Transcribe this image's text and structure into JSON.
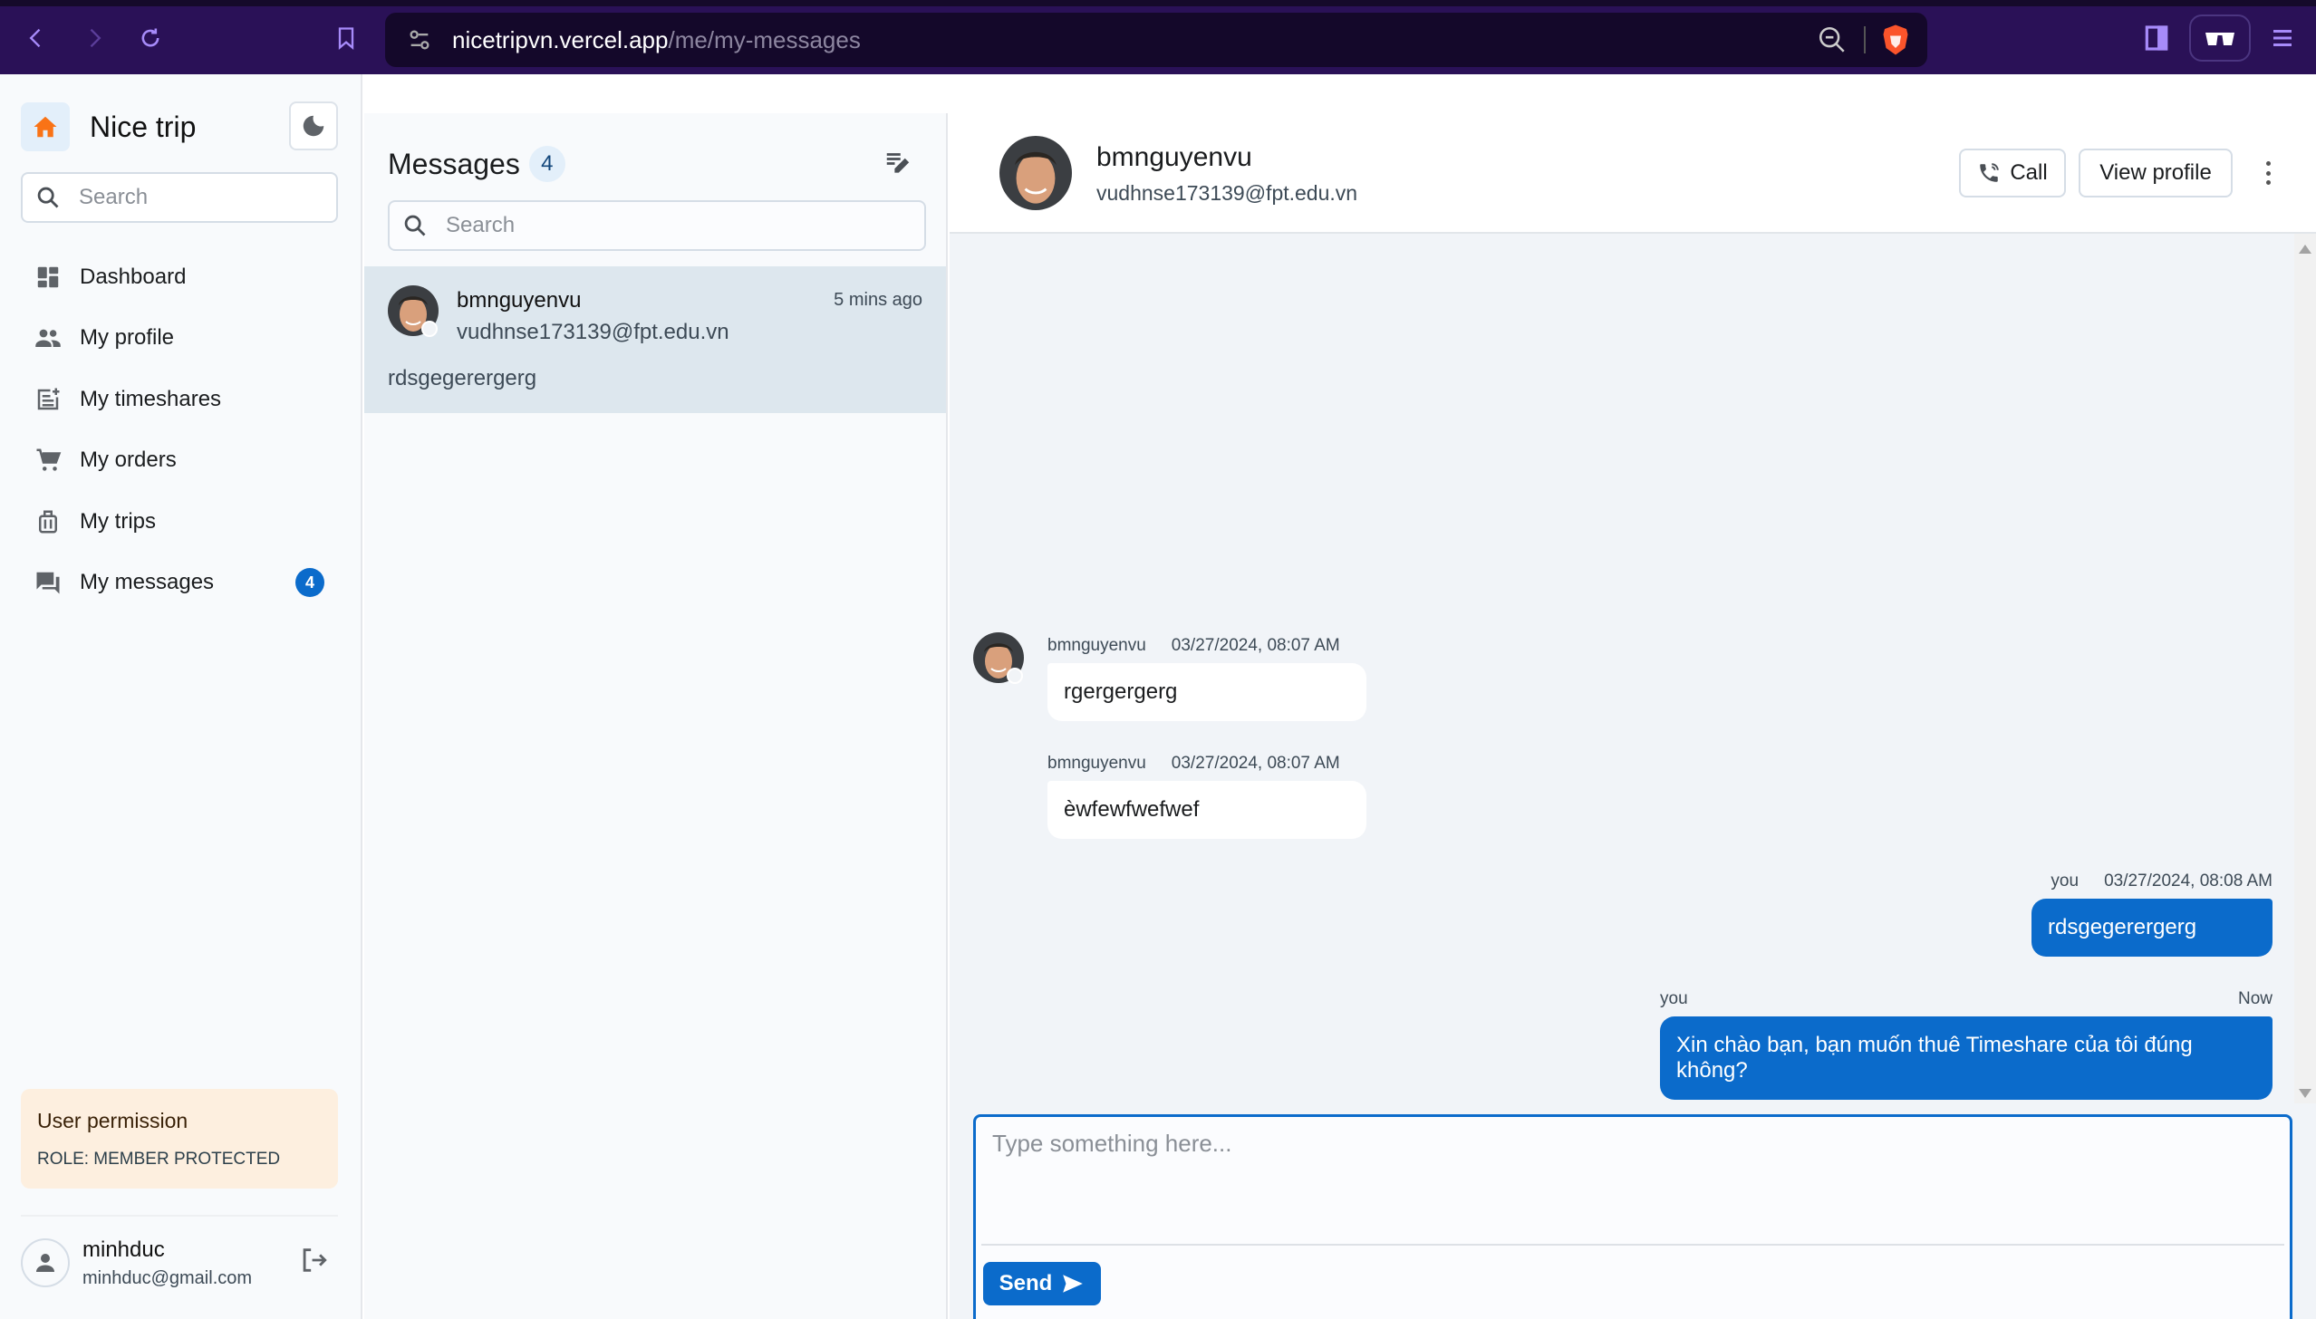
{
  "browser": {
    "url_host": "nicetripvn.vercel.app",
    "url_path": "/me/my-messages"
  },
  "sidebar": {
    "brand": "Nice trip",
    "search_placeholder": "Search",
    "items": [
      {
        "label": "Dashboard",
        "icon": "dashboard-icon"
      },
      {
        "label": "My profile",
        "icon": "people-icon"
      },
      {
        "label": "My timeshares",
        "icon": "post-add-icon"
      },
      {
        "label": "My orders",
        "icon": "cart-icon"
      },
      {
        "label": "My trips",
        "icon": "luggage-icon"
      },
      {
        "label": "My messages",
        "icon": "forum-icon",
        "badge": "4"
      }
    ],
    "permission": {
      "title": "User permission",
      "role": "ROLE: MEMBER PROTECTED"
    },
    "user": {
      "name": "minhduc",
      "email": "minhduc@gmail.com"
    }
  },
  "messages_list": {
    "title": "Messages",
    "count": "4",
    "search_placeholder": "Search",
    "conversations": [
      {
        "name": "bmnguyenvu",
        "email": "vudhnse173139@fpt.edu.vn",
        "time": "5 mins ago",
        "preview": "rdsgegerergerg"
      }
    ]
  },
  "chat": {
    "contact_name": "bmnguyenvu",
    "contact_email": "vudhnse173139@fpt.edu.vn",
    "call_label": "Call",
    "view_profile_label": "View profile",
    "messages": [
      {
        "sender": "bmnguyenvu",
        "time": "03/27/2024, 08:07 AM",
        "text": "rgergergerg",
        "direction": "in"
      },
      {
        "sender": "bmnguyenvu",
        "time": "03/27/2024, 08:07 AM",
        "text": "èwfewfwefwef",
        "direction": "in"
      },
      {
        "sender": "you",
        "time": "03/27/2024, 08:08 AM",
        "text": "rdsgegerergerg",
        "direction": "out"
      },
      {
        "sender": "you",
        "time": "Now",
        "text": "Xin chào bạn, bạn muốn thuê Timeshare của tôi đúng không?",
        "direction": "out"
      }
    ],
    "composer_placeholder": "Type something here...",
    "send_label": "Send"
  },
  "colors": {
    "browser_bg": "#2a1157",
    "accent": "#0b6bcb",
    "brand_orange": "#f97316",
    "permission_bg": "#fdefdf",
    "selected_conversation_bg": "#dde7ee"
  }
}
